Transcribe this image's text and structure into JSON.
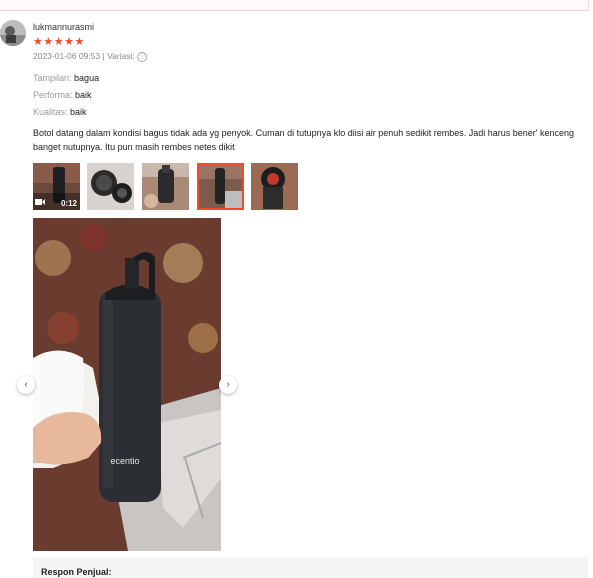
{
  "review": {
    "username": "lukmannurasmi",
    "stars": "★★★★★",
    "datetime": "2023-01-06 09:53",
    "variant_label": "Variasi:",
    "info_icon": "ⓘ",
    "attributes": [
      {
        "label": "Tampilan:",
        "value": "bagua"
      },
      {
        "label": "Performa:",
        "value": "baik"
      },
      {
        "label": "Kualitas:",
        "value": "baik"
      }
    ],
    "comment": "Botol datang dalam kondisi bagus tidak ada yg penyok. Cuman di tutupnya klo diisi air penuh sedikit rembes. Jadi harus bener' kenceng banget nutupnya. Itu pun masih rembes netes dikit",
    "video_duration": "0:12",
    "video_icon": "camera-icon",
    "bottle_brand": "ecentio",
    "selected_thumbnail": 4
  },
  "gallery": {
    "prev_icon": "‹",
    "next_icon": "›"
  },
  "seller_reply": {
    "title": "Respon Penjual:"
  },
  "colors": {
    "accent": "#ee4d2d",
    "muted": "#999999"
  }
}
